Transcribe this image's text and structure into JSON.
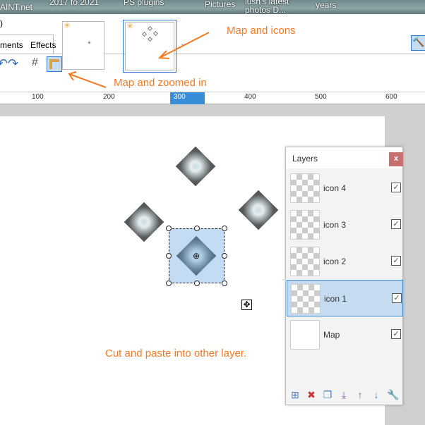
{
  "taskbar": {
    "items": [
      "AINT.net",
      "2017 to 2021",
      "PS plugins",
      "Pictures",
      "lush's latest photos D...",
      "years"
    ]
  },
  "menu": {
    "tabs": [
      "ments",
      "Effects"
    ],
    "fragment": ")"
  },
  "toolbar": {
    "icons": [
      "undo-icon",
      "redo-icon",
      "grid-icon",
      "ruler-icon"
    ],
    "thumbnail_more": "⌄"
  },
  "annotations": {
    "map_and_icons": "Map and icons",
    "map_zoomed": "Map and zoomed in",
    "cut_paste": "Cut and paste into other layer."
  },
  "ruler": {
    "labels": [
      "100",
      "200",
      "300",
      "400",
      "500",
      "600"
    ]
  },
  "layers": {
    "title": "Layers",
    "close": "x",
    "items": [
      {
        "name": "icon 4",
        "visible": true,
        "selected": false
      },
      {
        "name": "icon 3",
        "visible": true,
        "selected": false
      },
      {
        "name": "icon 2",
        "visible": true,
        "selected": false
      },
      {
        "name": "icon 1",
        "visible": true,
        "selected": true
      },
      {
        "name": "Map",
        "visible": true,
        "selected": false
      }
    ],
    "toolbar": [
      "add-layer-icon",
      "delete-layer-icon",
      "duplicate-layer-icon",
      "merge-down-icon",
      "move-up-icon",
      "move-down-icon",
      "properties-icon"
    ]
  },
  "colors": {
    "accent": "#f47920",
    "selection": "#c3dcf4",
    "close": "#c87070"
  }
}
